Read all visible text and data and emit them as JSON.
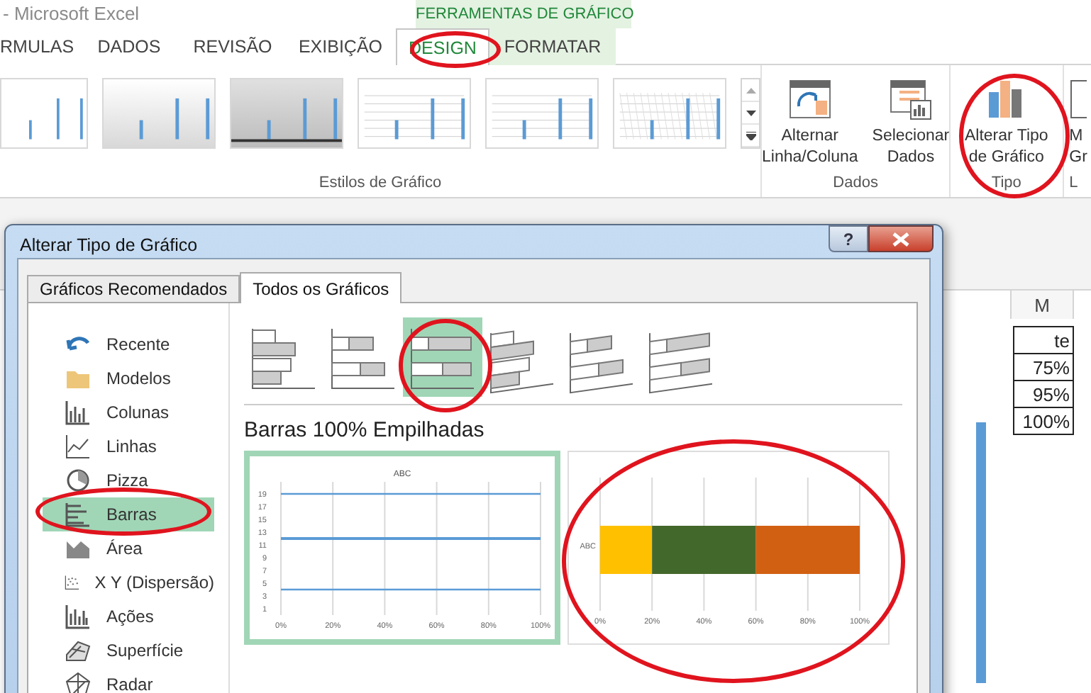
{
  "app_title": "- Microsoft Excel",
  "contextual_group": "FERRAMENTAS DE GRÁFICO",
  "ribbon_tabs": [
    {
      "label": "RMULAS",
      "selected": false,
      "contextual": false
    },
    {
      "label": "DADOS",
      "selected": false,
      "contextual": false
    },
    {
      "label": "REVISÃO",
      "selected": false,
      "contextual": false
    },
    {
      "label": "EXIBIÇÃO",
      "selected": false,
      "contextual": false
    },
    {
      "label": "DESIGN",
      "selected": true,
      "contextual": true
    },
    {
      "label": "FORMATAR",
      "selected": false,
      "contextual": true
    }
  ],
  "ribbon": {
    "styles_group": {
      "label": "Estilos de Gráfico",
      "styles": [
        {
          "kind": "plain"
        },
        {
          "kind": "gradient"
        },
        {
          "kind": "dark"
        },
        {
          "kind": "lines"
        },
        {
          "kind": "lines"
        },
        {
          "kind": "pattern"
        }
      ]
    },
    "data_group": {
      "label": "Dados",
      "buttons": [
        {
          "kind": "swap",
          "lines": [
            "Alternar",
            "Linha/Coluna"
          ]
        },
        {
          "kind": "select",
          "lines": [
            "Selecionar",
            "Dados"
          ]
        }
      ]
    },
    "type_group": {
      "label": "Tipo",
      "buttons": [
        {
          "kind": "change-type",
          "lines": [
            "Alterar Tipo",
            "de Gráfico"
          ]
        }
      ]
    },
    "cut_group": {
      "lines": [
        "M",
        "Gr"
      ],
      "label": "L"
    }
  },
  "dialog": {
    "title": "Alterar Tipo de Gráfico",
    "help": "?",
    "tabs": [
      {
        "label": "Gráficos Recomendados",
        "selected": false
      },
      {
        "label": "Todos os Gráficos",
        "selected": true
      }
    ],
    "categories": [
      {
        "label": "Recente",
        "kind": "recent",
        "selected": false
      },
      {
        "label": "Modelos",
        "kind": "folder",
        "selected": false
      },
      {
        "label": "Colunas",
        "kind": "columns",
        "selected": false
      },
      {
        "label": "Linhas",
        "kind": "lines",
        "selected": false
      },
      {
        "label": "Pizza",
        "kind": "pie",
        "selected": false
      },
      {
        "label": "Barras",
        "kind": "bars",
        "selected": true
      },
      {
        "label": "Área",
        "kind": "area",
        "selected": false
      },
      {
        "label": "X Y (Dispersão)",
        "kind": "scatter",
        "selected": false
      },
      {
        "label": "Ações",
        "kind": "stock",
        "selected": false
      },
      {
        "label": "Superfície",
        "kind": "surface",
        "selected": false
      },
      {
        "label": "Radar",
        "kind": "radar",
        "selected": false
      }
    ],
    "subtypes": [
      {
        "kind": "clustered",
        "selected": false
      },
      {
        "kind": "stacked",
        "selected": false
      },
      {
        "kind": "stacked100",
        "selected": true
      },
      {
        "kind": "clustered3d",
        "selected": false
      },
      {
        "kind": "stacked3d",
        "selected": false
      },
      {
        "kind": "stacked100-3d",
        "selected": false
      }
    ],
    "subtype_title": "Barras 100% Empilhadas",
    "previews": [
      {
        "selected": true,
        "chart_data": {
          "type": "line",
          "title": "ABC",
          "x": [
            0,
            100
          ],
          "series": [
            {
              "color": "#5b9bd5",
              "values": [
                19,
                19
              ]
            },
            {
              "color": "#5b9bd5",
              "values": [
                12,
                12
              ]
            },
            {
              "color": "#5b9bd5",
              "values": [
                4,
                4
              ]
            }
          ],
          "xlim": [
            0,
            100
          ],
          "ylim": [
            0,
            20
          ],
          "grid": true,
          "xticks": [
            {
              "value": 0,
              "label": "0%"
            },
            {
              "value": 20,
              "label": "20%"
            },
            {
              "value": 40,
              "label": "40%"
            },
            {
              "value": 60,
              "label": "60%"
            },
            {
              "value": 80,
              "label": "80%"
            },
            {
              "value": 100,
              "label": "100%"
            }
          ],
          "yticks": [
            1,
            3,
            5,
            7,
            9,
            11,
            13,
            15,
            17,
            19
          ]
        }
      },
      {
        "selected": false,
        "chart_data": {
          "type": "bar",
          "orientation": "horizontal",
          "stacked": true,
          "categories": [
            "ABC"
          ],
          "series": [
            {
              "color": "#ffc000",
              "values": [
                20
              ]
            },
            {
              "color": "#43682b",
              "values": [
                40
              ]
            },
            {
              "color": "#d26012",
              "values": [
                40
              ]
            }
          ],
          "xlim": [
            0,
            100
          ],
          "grid": true,
          "xticks": [
            {
              "value": 0,
              "label": "0%"
            },
            {
              "value": 20,
              "label": "20%"
            },
            {
              "value": 40,
              "label": "40%"
            },
            {
              "value": 60,
              "label": "60%"
            },
            {
              "value": 80,
              "label": "80%"
            },
            {
              "value": 100,
              "label": "100%"
            }
          ]
        }
      }
    ]
  },
  "sheet": {
    "column_header": "M",
    "cells": [
      "te",
      "75%",
      "95%",
      "100%"
    ]
  }
}
